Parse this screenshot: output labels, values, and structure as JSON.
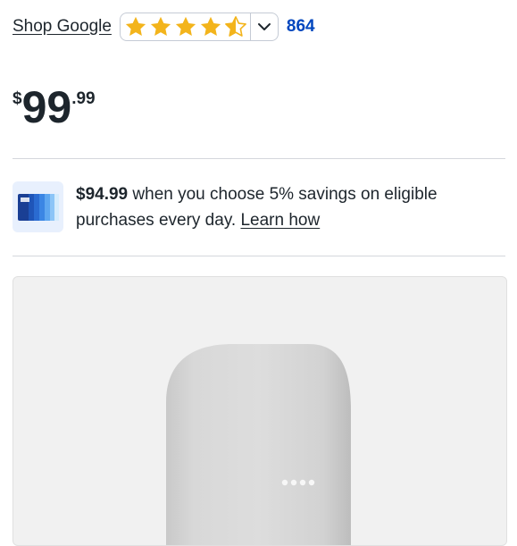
{
  "header": {
    "brand_link": "Shop Google",
    "rating": 4.5,
    "review_count": "864"
  },
  "price": {
    "currency": "$",
    "whole": "99",
    "cents": ".99"
  },
  "offer": {
    "amount": "$94.99",
    "text": " when you choose 5% savings on eligible purchases every day. ",
    "link": "Learn how"
  },
  "colors": {
    "star": "#f3b41b",
    "link_blue": "#0046be",
    "text": "#1d252c",
    "card_bg": "#e8f0fd"
  }
}
